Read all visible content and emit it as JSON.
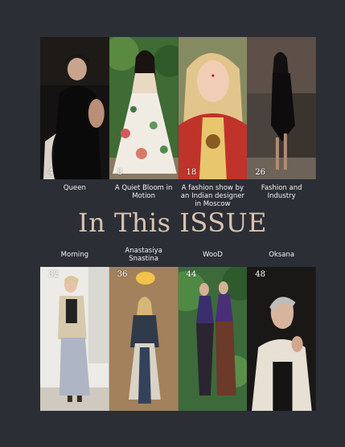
{
  "magazine": {
    "contents_title": "In This ISSUE",
    "top_items": [
      {
        "page": "4",
        "caption": "Queen"
      },
      {
        "page": "8",
        "caption": "A Quiet Bloom in Motion"
      },
      {
        "page": "18",
        "caption": "A fashion show by an Indian designer in Moscow"
      },
      {
        "page": "26",
        "caption": "Fashion and Industry"
      }
    ],
    "bottom_items": [
      {
        "page": "32",
        "caption": "Morning"
      },
      {
        "page": "36",
        "caption": "Anastasiya Snastina"
      },
      {
        "page": "44",
        "caption": "WooD"
      },
      {
        "page": "48",
        "caption": "Oksana"
      }
    ]
  },
  "colors": {
    "background": "#2b2e35",
    "title": "#d9c3b1"
  }
}
